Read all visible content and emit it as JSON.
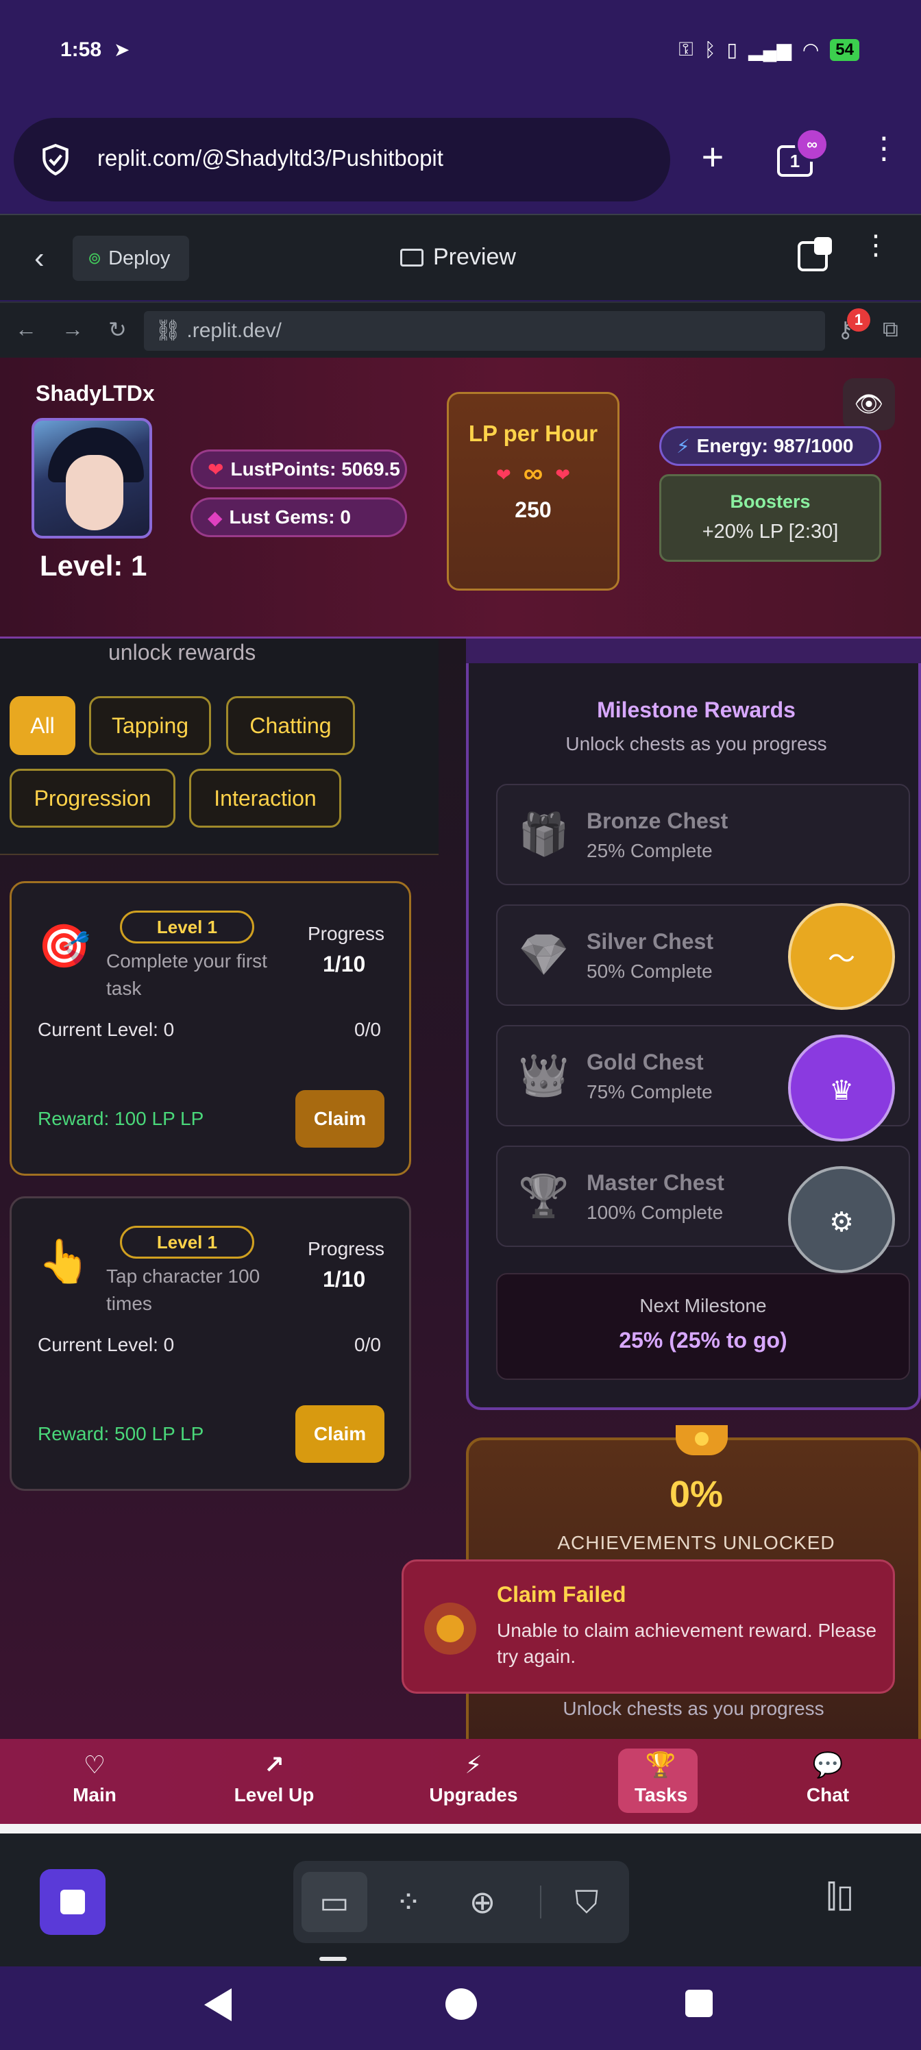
{
  "status": {
    "time": "1:58",
    "battery": "54"
  },
  "browser": {
    "url": "replit.com/@Shadyltd3/Pushitbopit",
    "tab_count": "1",
    "tab_badge": "∞"
  },
  "replit": {
    "deploy_label": "Deploy",
    "preview_label": "Preview",
    "address": ".replit.dev/",
    "key_badge": "1"
  },
  "game_header": {
    "username": "ShadyLTDx",
    "level_label": "Level: 1",
    "lustpoints": "LustPoints: 5069.5",
    "lustgems": "Lust Gems: 0",
    "lp_per_hour_title": "LP per Hour",
    "lp_per_hour_symbol": "∞",
    "lp_per_hour_value": "250",
    "energy": "Energy: 987/1000",
    "boosters_title": "Boosters",
    "boosters_value": "+20% LP [2:30]"
  },
  "tasks_panel": {
    "subtitle": "unlock rewards",
    "filters": [
      {
        "label": "All",
        "active": true
      },
      {
        "label": "Tapping",
        "active": false
      },
      {
        "label": "Chatting",
        "active": false
      },
      {
        "label": "Progression",
        "active": false
      },
      {
        "label": "Interaction",
        "active": false
      }
    ],
    "tasks": [
      {
        "icon": "🎯",
        "level": "Level 1",
        "description": "Complete your first task",
        "progress_label": "Progress",
        "progress_value": "1/10",
        "current_level": "Current Level: 0",
        "current_count": "0/0",
        "reward": "Reward: 100 LP LP",
        "claim_label": "Claim"
      },
      {
        "icon": "👆",
        "level": "Level 1",
        "description": "Tap character 100 times",
        "progress_label": "Progress",
        "progress_value": "1/10",
        "current_level": "Current Level: 0",
        "current_count": "0/0",
        "reward": "Reward: 500 LP LP",
        "claim_label": "Claim"
      }
    ]
  },
  "milestones": {
    "title": "Milestone Rewards",
    "subtitle": "Unlock chests as you progress",
    "chests": [
      {
        "icon": "🎁",
        "name": "Bronze Chest",
        "progress": "25% Complete"
      },
      {
        "icon": "💎",
        "name": "Silver Chest",
        "progress": "50% Complete"
      },
      {
        "icon": "👑",
        "name": "Gold Chest",
        "progress": "75% Complete"
      },
      {
        "icon": "🏆",
        "name": "Master Chest",
        "progress": "100% Complete"
      }
    ],
    "next_title": "Next Milestone",
    "next_value": "25% (25% to go)"
  },
  "achievements": {
    "percent": "0%",
    "label": "ACHIEVEMENTS UNLOCKED",
    "footer_sub": "Unlock chests as you progress"
  },
  "toast": {
    "title": "Claim Failed",
    "message": "Unable to claim achievement reward. Please try again."
  },
  "game_nav": [
    {
      "label": "Main",
      "icon": "heart-icon"
    },
    {
      "label": "Level Up",
      "icon": "trend-up-icon"
    },
    {
      "label": "Upgrades",
      "icon": "bolt-icon"
    },
    {
      "label": "Tasks",
      "icon": "trophy-icon",
      "active": true
    },
    {
      "label": "Chat",
      "icon": "chat-bubble-icon"
    }
  ],
  "colors": {
    "accent_gold": "#e8a820",
    "toast_bg": "#8a1a38",
    "nav_bg": "#8a1a48",
    "milestone_purple": "#d8a8ff"
  }
}
